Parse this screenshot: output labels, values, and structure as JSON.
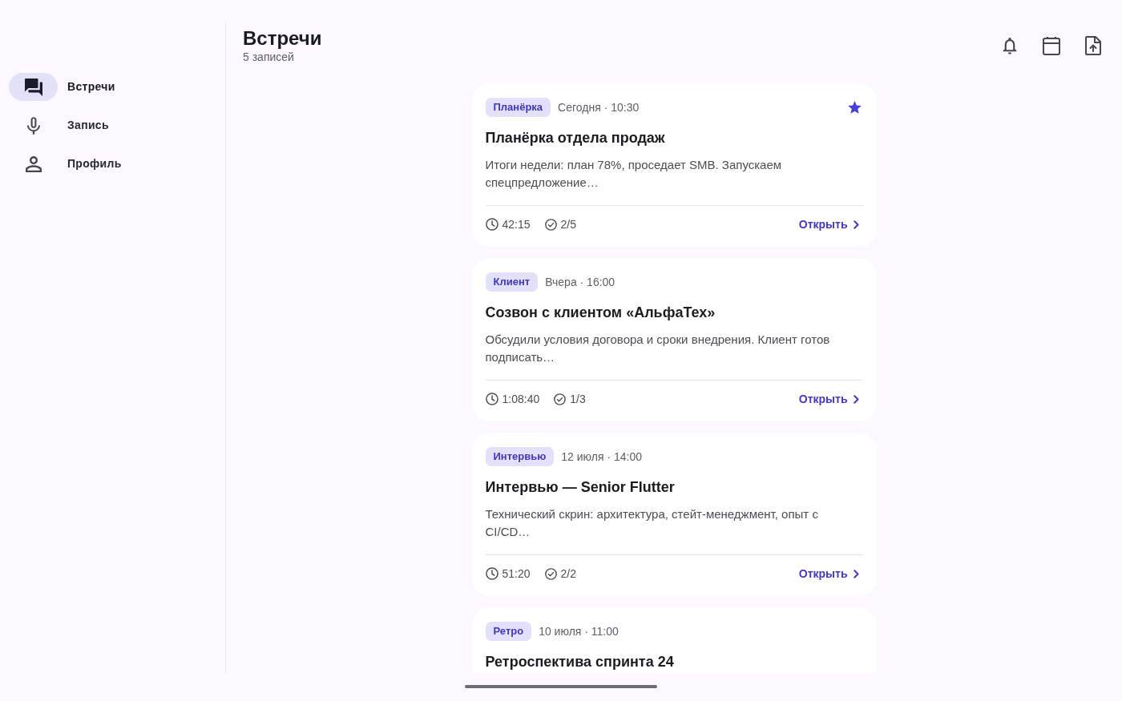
{
  "nav": {
    "items": [
      {
        "label": "Встречи",
        "selected": true
      },
      {
        "label": "Запись",
        "selected": false
      },
      {
        "label": "Профиль",
        "selected": false
      }
    ]
  },
  "header": {
    "title": "Встречи",
    "subtitle": "5 записей"
  },
  "meetings": [
    {
      "tag": "Планёрка",
      "when": "Сегодня · 10:30",
      "starred": true,
      "title": "Планёрка отдела продаж",
      "summary": "Итоги недели: план 78%, проседает SMB. Запускаем спецпредложение…",
      "duration": "42:15",
      "tasks": "2/5",
      "action": "Открыть"
    },
    {
      "tag": "Клиент",
      "when": "Вчера · 16:00",
      "starred": false,
      "title": "Созвон с клиентом «АльфаТех»",
      "summary": "Обсудили условия договора и сроки внедрения. Клиент готов подписать…",
      "duration": "1:08:40",
      "tasks": "1/3",
      "action": "Открыть"
    },
    {
      "tag": "Интервью",
      "when": "12 июля · 14:00",
      "starred": false,
      "title": "Интервью — Senior Flutter",
      "summary": "Технический скрин: архитектура, стейт-менеджмент, опыт с CI/CD…",
      "duration": "51:20",
      "tasks": "2/2",
      "action": "Открыть"
    },
    {
      "tag": "Ретро",
      "when": "10 июля · 11:00",
      "starred": false,
      "title": "Ретроспектива спринта 24"
    }
  ]
}
